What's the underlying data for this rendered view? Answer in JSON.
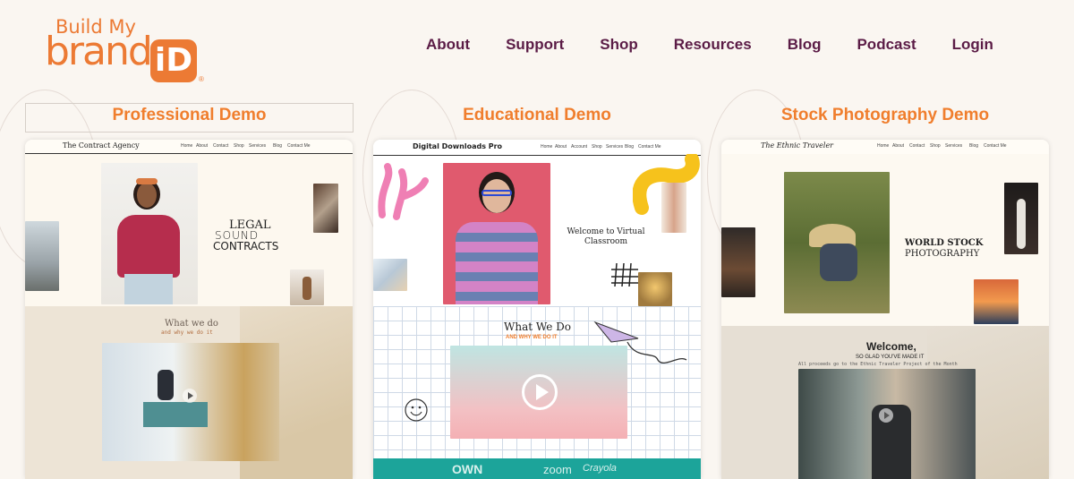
{
  "brand": {
    "logo_line1": "Build My",
    "logo_line2": "brand",
    "logo_badge": "iD",
    "logo_reg": "®"
  },
  "nav": [
    "About",
    "Support",
    "Shop",
    "Resources",
    "Blog",
    "Podcast",
    "Login"
  ],
  "demos": [
    {
      "title": "Professional Demo",
      "site_name": "The Contract Agency",
      "site_nav": [
        "Home",
        "About",
        "Contact",
        "Shop",
        "Services",
        "Blog",
        "Contact Me"
      ],
      "hero_text": [
        "LEGAL",
        "SOUND",
        "CONTRACTS"
      ],
      "section_title": "What we do",
      "section_sub": "and why we do it"
    },
    {
      "title": "Educational Demo",
      "site_name": "Digital Downloads Pro",
      "site_nav": [
        "Home",
        "About",
        "Account",
        "Shop",
        "Services",
        "Blog",
        "Contact Me"
      ],
      "hero_text": "Welcome to Virtual Classroom",
      "section_title": "What We Do",
      "section_sub": "AND WHY WE DO IT",
      "logos": [
        "OWN",
        "zoom",
        "Crayola"
      ]
    },
    {
      "title": "Stock Photography Demo",
      "site_name": "The Ethnic Traveler",
      "site_nav": [
        "Home",
        "About",
        "Contact",
        "Shop",
        "Services",
        "Blog",
        "Contact Me"
      ],
      "hero_text": [
        "WORLD STOCK",
        "PHOTOGRAPHY"
      ],
      "section_title": "Welcome,",
      "section_sub": "SO GLAD YOU'VE MADE IT",
      "section_note": "All proceeds go to the Ethnic Traveler Project of the Month"
    }
  ],
  "colors": {
    "accent": "#f07e2d",
    "nav_text": "#5b1c46",
    "background": "#faf6f1",
    "teal": "#1ca49a"
  }
}
